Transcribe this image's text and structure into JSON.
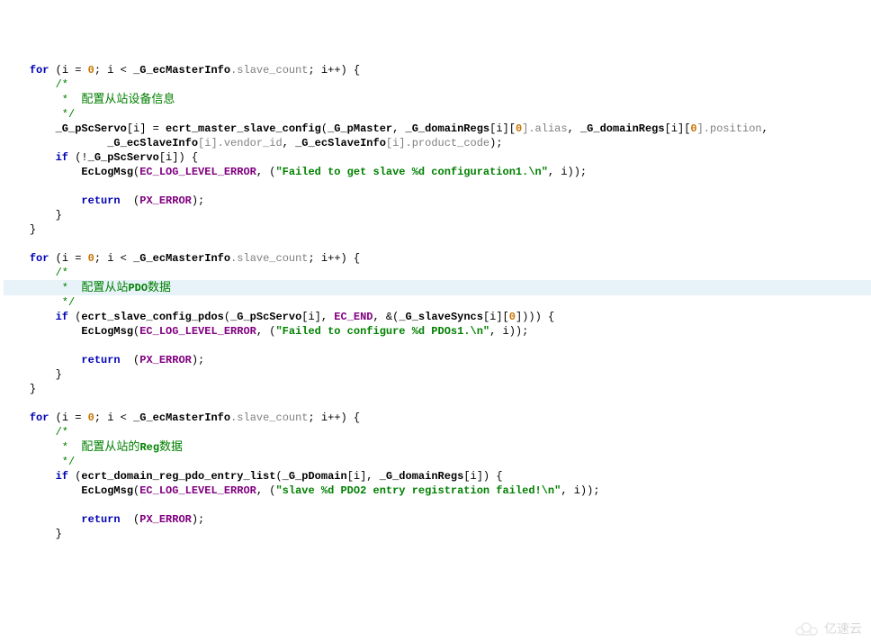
{
  "code": {
    "loop1": {
      "for": "for",
      "open": " (i = ",
      "zero": "0",
      "cond": "; i < ",
      "gvar": "_G_ecMasterInfo",
      "mem": ".slave_count",
      "inc": "; i++) {",
      "c1": "/*",
      "c2_pre": " *  ",
      "c2_cn": "配置从站设备信息",
      "c3": " */",
      "assign_l": "_G_pScServo",
      "assign_idx": "[i] = ",
      "fn": "ecrt_master_slave_config",
      "args_open": "(",
      "a1": "_G_pMaster",
      "a2": "_G_domainRegs",
      "a2_suf": "[i][",
      "a2_zero": "0",
      "a2_mem": "].alias",
      "a3": "_G_domainRegs",
      "a3_suf": "[i][",
      "a3_zero": "0",
      "a3_mem": "].position",
      "line2_a": "_G_ecSlaveInfo",
      "line2_a_mem": "[i].vendor_id",
      "line2_b": "_G_ecSlaveInfo",
      "line2_b_mem": "[i].product_code",
      "if": "if",
      "if_cond_open": " (!",
      "if_var": "_G_pScServo",
      "if_cond_close": "[i]) {",
      "log_fn": "EcLogMsg",
      "log_lvl": "EC_LOG_LEVEL_ERROR",
      "log_str": "\"Failed to get slave %d configuration1.\\n\"",
      "ret": "return",
      "ret_val": "PX_ERROR"
    },
    "loop2": {
      "c2_cn_a": "配置从站",
      "c2_bold": "PDO",
      "c2_cn_b": "数据",
      "fn": "ecrt_slave_config_pdos",
      "a1": "_G_pScServo",
      "a1_suf": "[i]",
      "a2": "EC_END",
      "a3_pre": "&(",
      "a3": "_G_slaveSyncs",
      "a3_suf": "[i][",
      "a3_zero": "0",
      "a3_close": "]))) {",
      "log_str": "\"Failed to configure %d PDOs1.\\n\""
    },
    "loop3": {
      "c2_cn_a": "配置从站的",
      "c2_bold": "Reg",
      "c2_cn_b": "数据",
      "fn": "ecrt_domain_reg_pdo_entry_list",
      "a1": "_G_pDomain",
      "a1_suf": "[i]",
      "a2": "_G_domainRegs",
      "a2_suf": "[i]) {",
      "log_str": "\"slave %d PDO2 entry registration failed!\\n\""
    }
  },
  "watermark": "亿速云"
}
